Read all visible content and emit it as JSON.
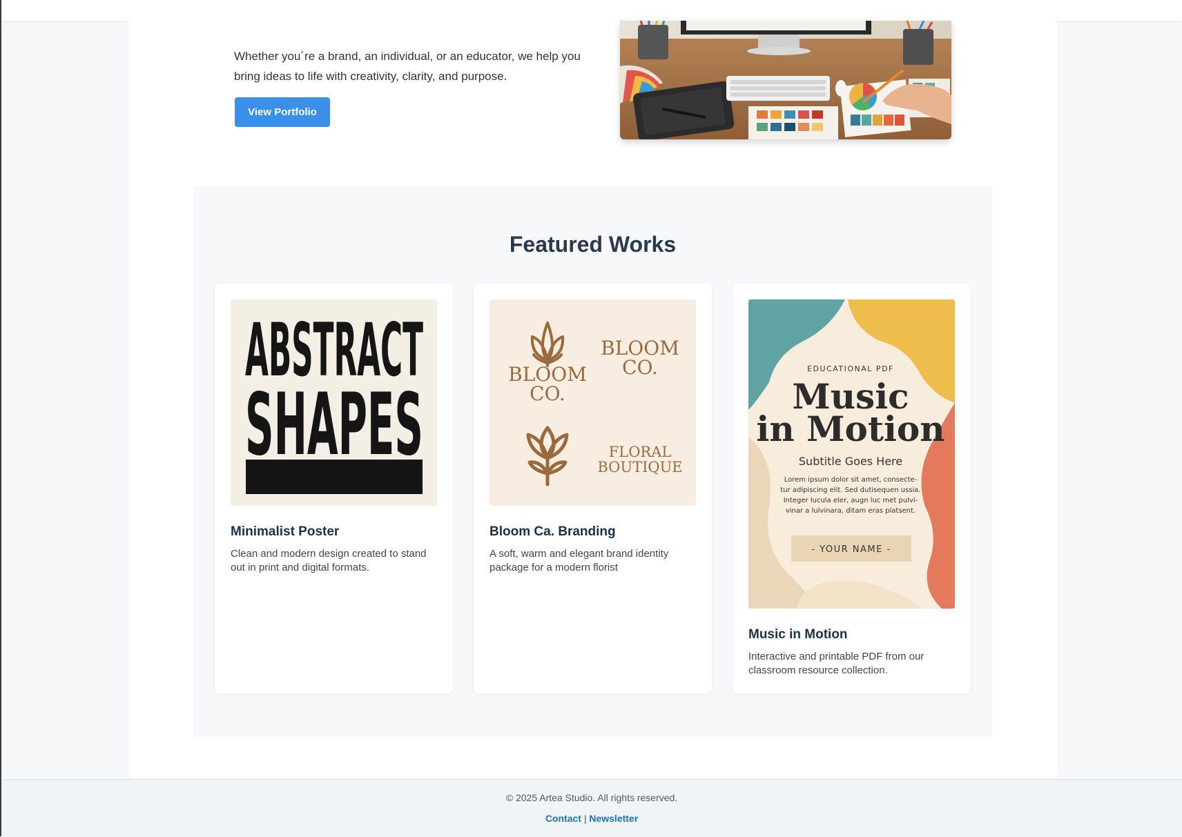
{
  "hero": {
    "text": "Whether you´re a brand, an individual, or an educator, we help you bring ideas to life with creativity, clarity, and purpose.",
    "button_label": "View Portfolio",
    "image_icon": "design-desk-photo"
  },
  "featured": {
    "title": "Featured Works",
    "cards": [
      {
        "title": "Minimalist Poster",
        "description": "Clean and modern design created to stand out in print and digital formats.",
        "image": {
          "line1": "ABSTRACT",
          "line2": "SHAPES"
        }
      },
      {
        "title": "Bloom Ca. Branding",
        "description": "A soft, warm and elegant brand identity package for a modern florist",
        "image": {
          "logo1_line1": "BLOOM",
          "logo1_line2": "CO.",
          "logo2_line1": "BLOOM",
          "logo2_line2": "CO.",
          "logo3_line1": "FLORAL",
          "logo3_line2": "BOUTIQUE"
        }
      },
      {
        "title": "Music in Motion",
        "description": "Interactive and printable PDF from our classroom resource collection.",
        "image": {
          "kicker": "EDUCATIONAL PDF",
          "headline_line1": "Music",
          "headline_line2": "in Motion",
          "subtitle": "Subtitle Goes Here",
          "body_lines": [
            "Lorem ipsum dolor sit amet, consecte-",
            "tur adipiscing elit. Sed dutisequen ussia.",
            "Integer lucula eler, augn luc met pulvi-",
            "vinar a lulvinara, ditam eras platsent."
          ],
          "name_tag": "- YOUR NAME -"
        }
      }
    ]
  },
  "footer": {
    "copyright": "© 2025 Artea Studio. All rights reserved.",
    "contact_label": "Contact",
    "separator": "|",
    "newsletter_label": "Newsletter"
  },
  "colors": {
    "accent": "#3a8fe8",
    "title_dark": "#2b3a4b",
    "link": "#1c72b0",
    "bloom_brown": "#9a6a3e",
    "poster_cream": "#f4efe4"
  }
}
